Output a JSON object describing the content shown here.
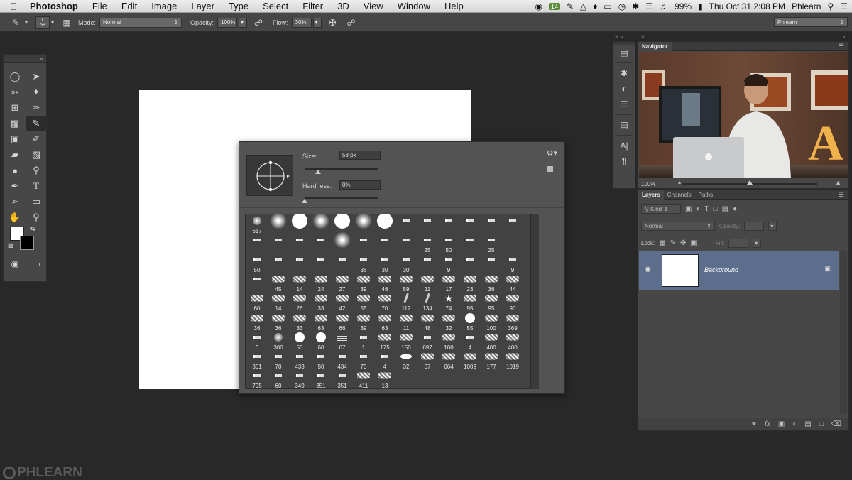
{
  "menubar": {
    "app": "Photoshop",
    "menus": [
      "File",
      "Edit",
      "Image",
      "Layer",
      "Type",
      "Select",
      "Filter",
      "3D",
      "View",
      "Window",
      "Help"
    ],
    "badge": "14",
    "battery": "99%",
    "clock": "Thu Oct 31  2:08 PM",
    "user": "Phlearn"
  },
  "options": {
    "brush_size": "58",
    "mode_label": "Mode:",
    "mode_value": "Normal",
    "opacity_label": "Opacity:",
    "opacity_value": "100%",
    "flow_label": "Flow:",
    "flow_value": "30%",
    "workspace": "Phlearn"
  },
  "brush_picker": {
    "size_label": "Size:",
    "size_value": "58 px",
    "size_fraction": 0.18,
    "hardness_label": "Hardness:",
    "hardness_value": "0%",
    "hardness_fraction": 0.0,
    "rows": [
      [
        [
          "soft",
          "617"
        ],
        [
          "soft-lg",
          ""
        ],
        [
          "hard-lg",
          ""
        ],
        [
          "soft-lg",
          ""
        ],
        [
          "hard-lg",
          ""
        ],
        [
          "soft-lg",
          ""
        ],
        [
          "hard-lg",
          ""
        ],
        [
          "dash",
          ""
        ],
        [
          "dash",
          ""
        ],
        [
          "dash",
          ""
        ],
        [
          "dash",
          ""
        ],
        [
          "dash",
          ""
        ],
        [
          "dash",
          ""
        ]
      ],
      [
        [
          "dash",
          ""
        ],
        [
          "dash",
          ""
        ],
        [
          "dash",
          ""
        ],
        [
          "dash",
          ""
        ],
        [
          "soft-lg",
          ""
        ],
        [
          "dash",
          ""
        ],
        [
          "dash",
          ""
        ],
        [
          "dash",
          ""
        ],
        [
          "dash",
          "25"
        ],
        [
          "dash",
          "50"
        ],
        [
          "dash",
          ""
        ],
        [
          "dash",
          "25"
        ]
      ],
      [
        [
          "dash",
          "50"
        ],
        [
          "dash",
          ""
        ],
        [
          "dash",
          ""
        ],
        [
          "dash",
          ""
        ],
        [
          "dash",
          ""
        ],
        [
          "dash",
          "36"
        ],
        [
          "dash",
          "30"
        ],
        [
          "dash",
          "30"
        ],
        [
          "dash",
          ""
        ],
        [
          "dash",
          "9"
        ],
        [
          "dash",
          ""
        ],
        [
          "dash",
          ""
        ],
        [
          "dash",
          "9"
        ]
      ],
      [
        [
          "dash",
          ""
        ],
        [
          "scatter",
          "45"
        ],
        [
          "scatter",
          "14"
        ],
        [
          "scatter",
          "24"
        ],
        [
          "scatter",
          "27"
        ],
        [
          "scatter",
          "39"
        ],
        [
          "scatter",
          "46"
        ],
        [
          "scatter",
          "59"
        ],
        [
          "scatter",
          "11"
        ],
        [
          "scatter",
          "17"
        ],
        [
          "scatter",
          "23"
        ],
        [
          "scatter",
          "36"
        ],
        [
          "scatter",
          "44"
        ]
      ],
      [
        [
          "scatter",
          "60"
        ],
        [
          "scatter",
          "14"
        ],
        [
          "scatter",
          "26"
        ],
        [
          "scatter",
          "33"
        ],
        [
          "scatter",
          "42"
        ],
        [
          "scatter",
          "55"
        ],
        [
          "scatter",
          "70"
        ],
        [
          "grass",
          "112"
        ],
        [
          "grass",
          "134"
        ],
        [
          "star",
          "74"
        ],
        [
          "scatter",
          "95"
        ],
        [
          "scatter",
          "95"
        ],
        [
          "scatter",
          "90"
        ]
      ],
      [
        [
          "scatter",
          "36"
        ],
        [
          "scatter",
          "36"
        ],
        [
          "scatter",
          "33"
        ],
        [
          "scatter",
          "63"
        ],
        [
          "scatter",
          "66"
        ],
        [
          "scatter",
          "39"
        ],
        [
          "scatter",
          "63"
        ],
        [
          "scatter",
          "11"
        ],
        [
          "scatter",
          "48"
        ],
        [
          "scatter",
          "32"
        ],
        [
          "hard",
          "55"
        ],
        [
          "scatter",
          "100"
        ],
        [
          "scatter",
          "369"
        ]
      ],
      [
        [
          "dash",
          "6"
        ],
        [
          "soft",
          "300"
        ],
        [
          "hard",
          "50"
        ],
        [
          "hard",
          "60"
        ],
        [
          "lines",
          "67"
        ],
        [
          "dash",
          "1"
        ],
        [
          "scatter",
          "175"
        ],
        [
          "scatter",
          "150"
        ],
        [
          "dash",
          "697"
        ],
        [
          "scatter",
          "100"
        ],
        [
          "dash",
          "4"
        ],
        [
          "scatter",
          "400"
        ],
        [
          "scatter",
          "400"
        ]
      ],
      [
        [
          "dash",
          "361"
        ],
        [
          "dash",
          "70"
        ],
        [
          "dash",
          "433"
        ],
        [
          "dash",
          "50"
        ],
        [
          "dash",
          "434"
        ],
        [
          "dash",
          "70"
        ],
        [
          "dash",
          "4"
        ],
        [
          "oval",
          "32"
        ],
        [
          "scatter",
          "67"
        ],
        [
          "scatter",
          "664"
        ],
        [
          "scatter",
          "1009"
        ],
        [
          "scatter",
          "177"
        ],
        [
          "scatter",
          "1019"
        ]
      ],
      [
        [
          "dash",
          "795"
        ],
        [
          "dash",
          "60"
        ],
        [
          "dash",
          "349"
        ],
        [
          "dash",
          "351"
        ],
        [
          "dash",
          "351"
        ],
        [
          "scatter",
          "411"
        ],
        [
          "scatter",
          "13"
        ]
      ]
    ]
  },
  "navigator": {
    "tab": "Navigator",
    "zoom": "100%",
    "zoom_fraction": 0.5
  },
  "layers": {
    "tabs": [
      "Layers",
      "Channels",
      "Paths"
    ],
    "kind_label": "Kind",
    "blend_mode": "Normal",
    "opacity_label": "Opacity:",
    "lock_label": "Lock:",
    "fill_label": "Fill:",
    "layer_name": "Background"
  },
  "watermark": "PHLEARN",
  "colors": {
    "foreground": "#ffffff",
    "background": "#000000",
    "layer_selected": "#5c6e8c"
  }
}
